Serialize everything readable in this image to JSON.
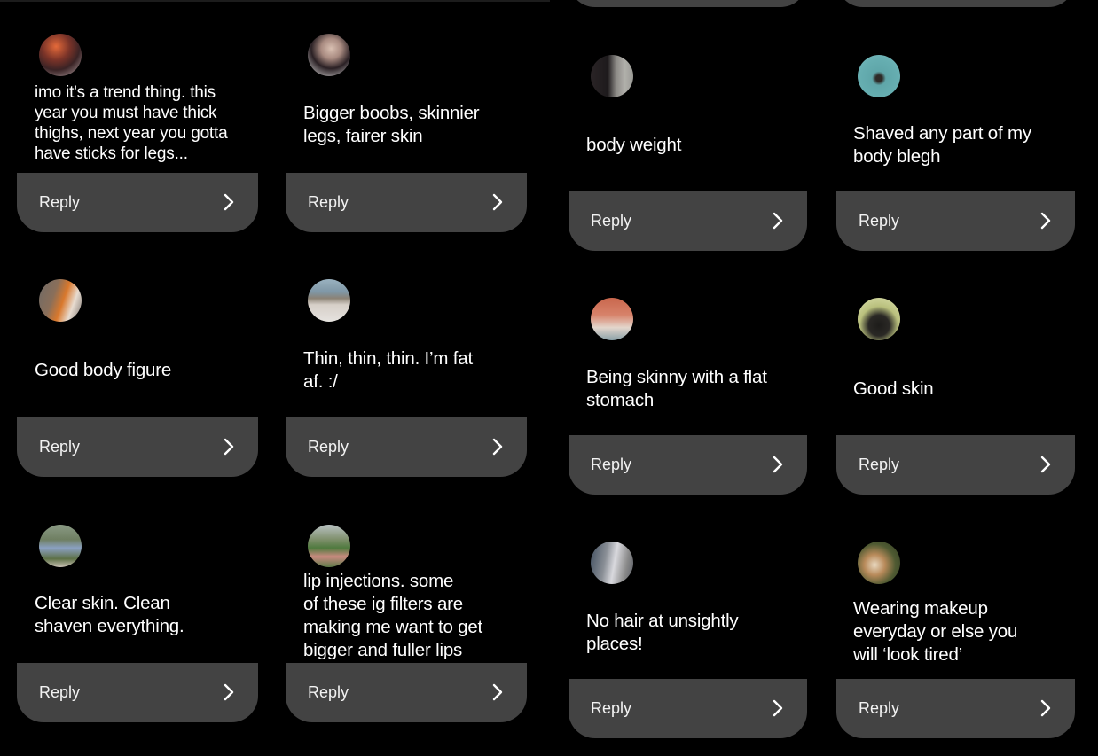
{
  "reply_label": "Reply",
  "colors": {
    "background": "#000000",
    "reply_bar": "#434343",
    "text": "#ffffff"
  },
  "left_panel": {
    "cards": [
      {
        "avatar": "avatar-photo-person-indoors",
        "message": "imo it's a trend thing. this\nyear you must have thick\nthighs, next year you gotta\nhave sticks for legs..."
      },
      {
        "avatar": "avatar-photo-woman-selfie",
        "message": "Bigger boobs, skinnier\nlegs, fairer skin"
      },
      {
        "avatar": "avatar-photo-tree-orange",
        "message": "Good body figure"
      },
      {
        "avatar": "avatar-photo-beach-person",
        "message": "Thin, thin, thin. I’m fat\naf. :/"
      },
      {
        "avatar": "avatar-photo-person-outdoors",
        "message": "Clear skin. Clean\nshaven everything."
      },
      {
        "avatar": "avatar-photo-woman-pink-dress",
        "message": "lip injections. some\nof these ig filters are\nmaking me want to get\nbigger and fuller lips"
      }
    ]
  },
  "right_panel": {
    "cards": [
      {
        "avatar": "avatar-photo-woman-dark-hair",
        "message": "body weight"
      },
      {
        "avatar": "avatar-photo-swimmer",
        "message": "Shaved any part of my\nbody blegh"
      },
      {
        "avatar": "avatar-photo-woman-bench",
        "message": "Being skinny with a flat\nstomach"
      },
      {
        "avatar": "avatar-photo-woman-scarf",
        "message": "Good skin"
      },
      {
        "avatar": "avatar-photo-woman-holding",
        "message": "No hair at unsightly\nplaces!"
      },
      {
        "avatar": "avatar-photo-monkey",
        "message": "Wearing makeup\neveryday or else you\nwill ‘look tired’"
      }
    ]
  }
}
